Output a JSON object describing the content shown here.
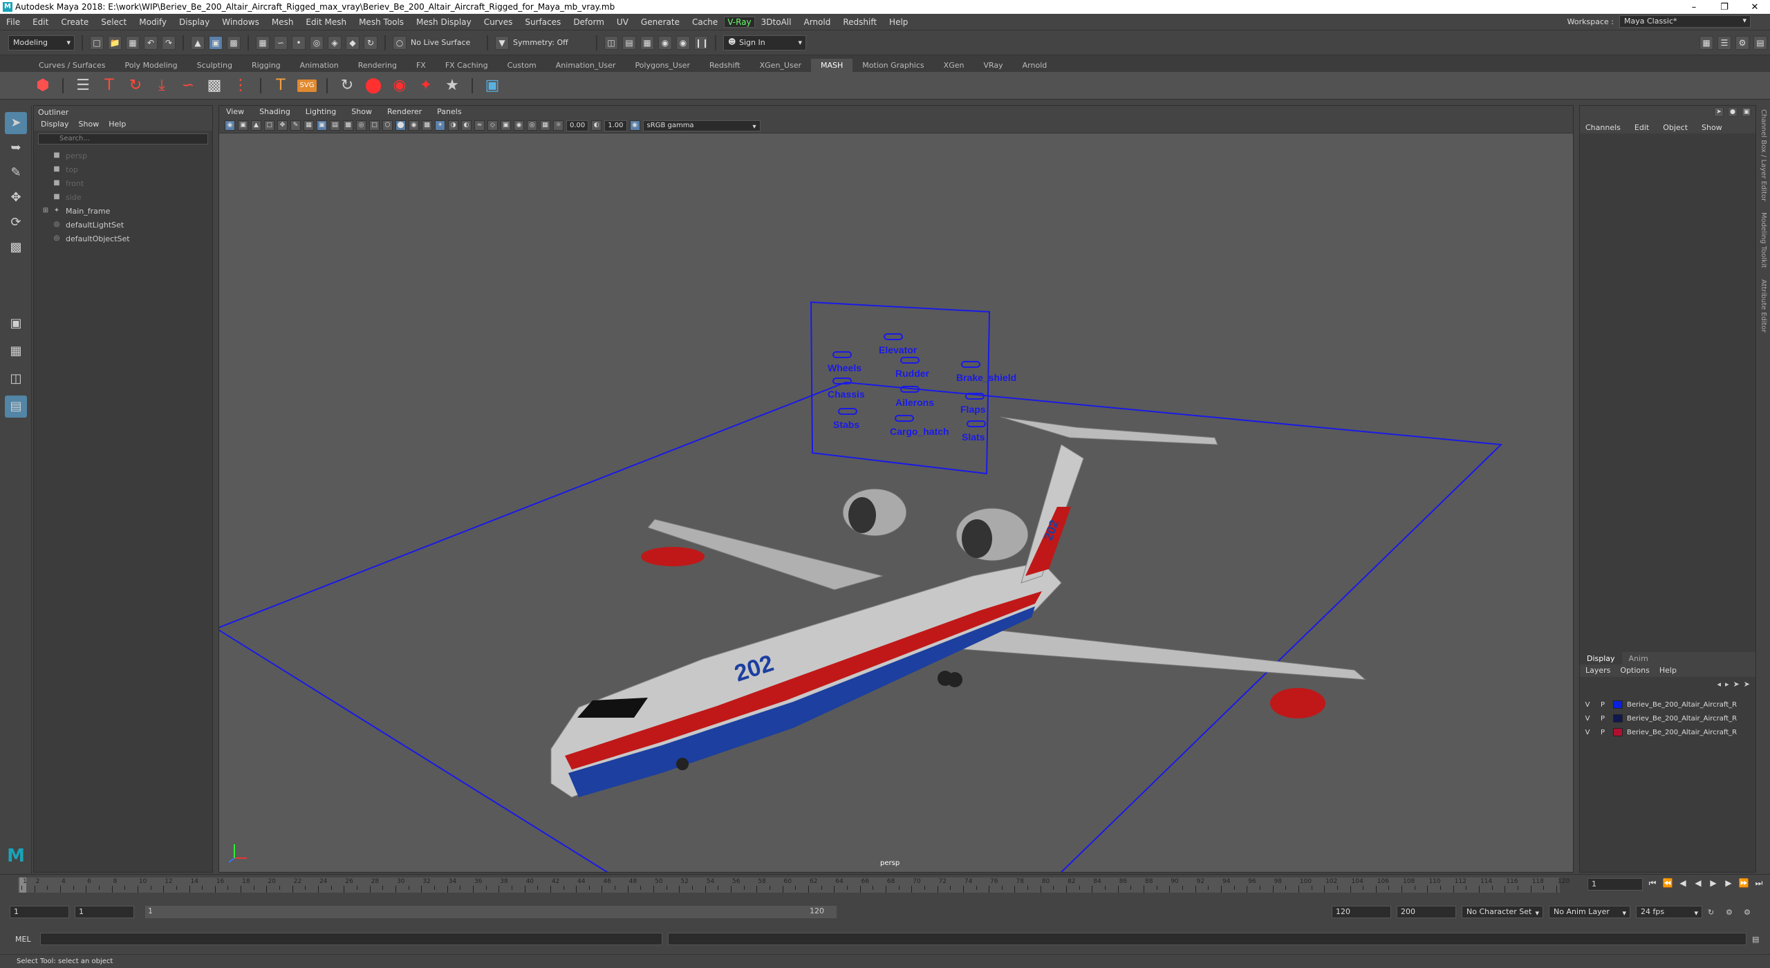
{
  "window": {
    "title": "Autodesk Maya 2018: E:\\work\\WIP\\Beriev_Be_200_Altair_Aircraft_Rigged_max_vray\\Beriev_Be_200_Altair_Aircraft_Rigged_for_Maya_mb_vray.mb"
  },
  "menubar": {
    "items": [
      "File",
      "Edit",
      "Create",
      "Select",
      "Modify",
      "Display",
      "Windows",
      "Mesh",
      "Edit Mesh",
      "Mesh Tools",
      "Mesh Display",
      "Curves",
      "Surfaces",
      "Deform",
      "UV",
      "Generate",
      "Cache",
      "V-Ray",
      "3DtoAll",
      "Arnold",
      "Redshift",
      "Help"
    ],
    "workspace_label": "Workspace :",
    "workspace_value": "Maya Classic*"
  },
  "statusline": {
    "mode": "Modeling",
    "live_surface": "No Live Surface",
    "symmetry": "Symmetry: Off",
    "sign_in": "Sign In"
  },
  "shelf": {
    "tabs": [
      "Curves / Surfaces",
      "Poly Modeling",
      "Sculpting",
      "Rigging",
      "Animation",
      "Rendering",
      "FX",
      "FX Caching",
      "Custom",
      "Animation_User",
      "Polygons_User",
      "Redshift",
      "XGen_User",
      "MASH",
      "Motion Graphics",
      "XGen",
      "VRay",
      "Arnold"
    ],
    "active_tab": "MASH",
    "svg_label": "SVG"
  },
  "outliner": {
    "title": "Outliner",
    "menu": [
      "Display",
      "Show",
      "Help"
    ],
    "search_placeholder": "Search...",
    "items": [
      {
        "label": "persp",
        "dim": true
      },
      {
        "label": "top",
        "dim": true
      },
      {
        "label": "front",
        "dim": true
      },
      {
        "label": "side",
        "dim": true
      },
      {
        "label": "Main_frame",
        "dim": false
      },
      {
        "label": "defaultLightSet",
        "dim": false
      },
      {
        "label": "defaultObjectSet",
        "dim": false
      }
    ]
  },
  "viewport": {
    "menu": [
      "View",
      "Shading",
      "Lighting",
      "Show",
      "Renderer",
      "Panels"
    ],
    "exposure": "0.00",
    "gamma": "1.00",
    "color_space": "sRGB gamma",
    "camera": "persp",
    "controls": [
      "Elevator",
      "Wheels",
      "Rudder",
      "Brake_shield",
      "Chassis",
      "Ailerons",
      "Flaps",
      "Stabs",
      "Cargo_hatch",
      "Slats"
    ],
    "fuselage_number": "202",
    "tail_number": "202"
  },
  "channelbox": {
    "menu": [
      "Channels",
      "Edit",
      "Object",
      "Show"
    ],
    "side_tabs": [
      "Channel Box / Layer Editor",
      "Modeling Toolkit",
      "Attribute Editor"
    ]
  },
  "layers": {
    "tabs": [
      "Display",
      "Anim"
    ],
    "menu": [
      "Layers",
      "Options",
      "Help"
    ],
    "rows": [
      {
        "v": "V",
        "p": "P",
        "name": "Beriev_Be_200_Altair_Aircraft_R",
        "color": "#0a20e0"
      },
      {
        "v": "V",
        "p": "P",
        "name": "Beriev_Be_200_Altair_Aircraft_R",
        "color": "#101850"
      },
      {
        "v": "V",
        "p": "P",
        "name": "Beriev_Be_200_Altair_Aircraft_R",
        "color": "#b01030"
      }
    ]
  },
  "timeline": {
    "ticks": [
      "1",
      "2",
      "4",
      "6",
      "8",
      "10",
      "12",
      "14",
      "16",
      "18",
      "20",
      "22",
      "24",
      "26",
      "28",
      "30",
      "32",
      "34",
      "36",
      "38",
      "40",
      "42",
      "44",
      "46",
      "48",
      "50",
      "52",
      "54",
      "56",
      "58",
      "60",
      "62",
      "64",
      "66",
      "68",
      "70",
      "72",
      "74",
      "76",
      "78",
      "80",
      "82",
      "84",
      "86",
      "88",
      "90",
      "92",
      "94",
      "96",
      "98",
      "100",
      "102",
      "104",
      "106",
      "108",
      "110",
      "112",
      "114",
      "116",
      "118",
      "120"
    ],
    "current_frame": "1"
  },
  "range": {
    "start": "1",
    "start2": "1",
    "slider_start": "1",
    "slider_end": "120",
    "end": "120",
    "end2": "200",
    "character_set": "No Character Set",
    "anim_layer": "No Anim Layer",
    "fps": "24 fps"
  },
  "commandline": {
    "label": "MEL"
  },
  "helpline": {
    "text": "Select Tool: select an object"
  }
}
